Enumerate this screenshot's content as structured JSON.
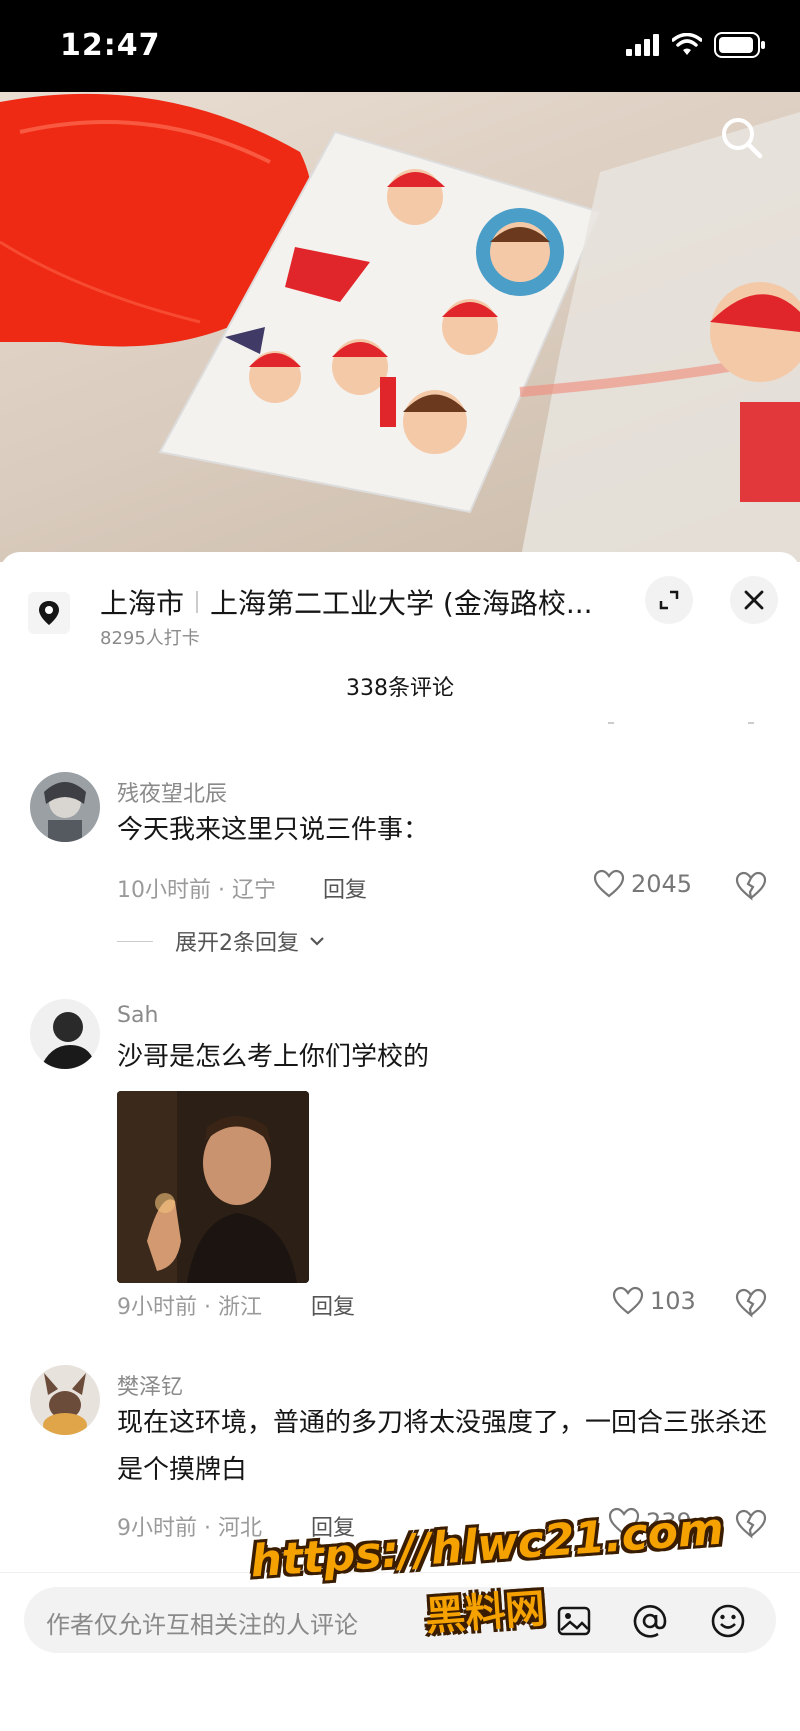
{
  "status_bar": {
    "time": "12:47"
  },
  "location": {
    "city": "上海市",
    "place": "上海第二工业大学 (金海路校...",
    "checkins": "8295人打卡"
  },
  "comments_header": {
    "count_label": "338条评论"
  },
  "comments": [
    {
      "user": "残夜望北辰",
      "text": "今天我来这里只说三件事：",
      "meta": "10小时前 · 辽宁",
      "reply_label": "回复",
      "likes": "2045",
      "expand_label": "展开2条回复"
    },
    {
      "user": "Sah",
      "text": "沙哥是怎么考上你们学校的",
      "meta": "9小时前 · 浙江",
      "reply_label": "回复",
      "likes": "103"
    },
    {
      "user": "樊泽钇",
      "text": "现在这环境，普通的多刀将太没强度了，一回合三张杀还是个摸牌白",
      "meta": "9小时前 · 河北",
      "reply_label": "回复",
      "likes": "239"
    }
  ],
  "input": {
    "placeholder": "作者仅允许互相关注的人评论"
  },
  "watermark": {
    "url": "https://hlwc21.com",
    "name": "黑料网"
  },
  "colors": {
    "accent": "#161616",
    "muted": "#8a8a8a",
    "watermark": "#f5a200"
  },
  "icons": [
    "signal-icon",
    "wifi-icon",
    "battery-icon",
    "search-icon",
    "location-pin-icon",
    "expand-icon",
    "close-icon",
    "heart-icon",
    "broken-heart-icon",
    "chevron-down-icon",
    "image-icon",
    "at-icon",
    "emoji-icon"
  ]
}
